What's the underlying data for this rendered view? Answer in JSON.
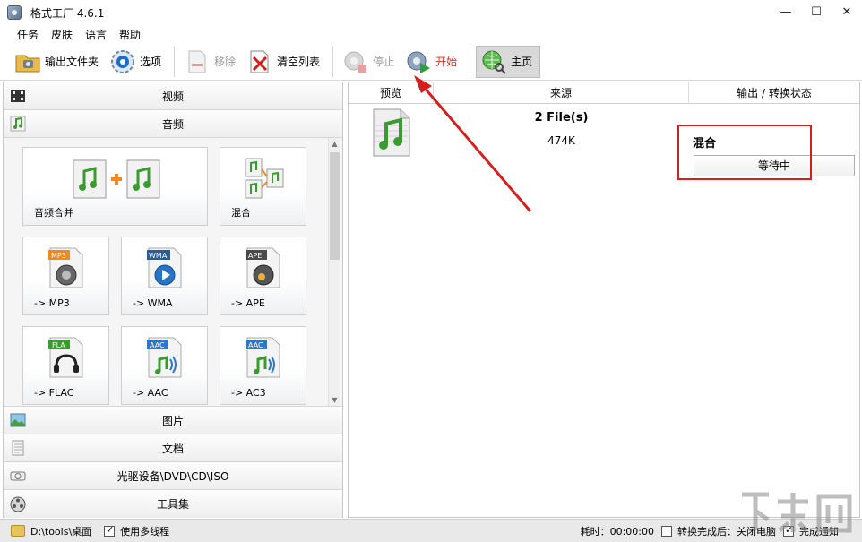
{
  "window": {
    "title": "格式工厂 4.6.1",
    "controls": [
      "—",
      "☐",
      "✕"
    ]
  },
  "menu": [
    "任务",
    "皮肤",
    "语言",
    "帮助"
  ],
  "toolbar": {
    "output_folder": "输出文件夹",
    "options": "选项",
    "remove": "移除",
    "clear_list": "清空列表",
    "stop": "停止",
    "start": "开始",
    "home": "主页"
  },
  "categories": {
    "video": "视频",
    "audio": "音频",
    "picture": "图片",
    "document": "文档",
    "rom": "光驱设备\\DVD\\CD\\ISO",
    "tools": "工具集"
  },
  "audio_tiles": [
    {
      "label": "音频合并"
    },
    {
      "label": "混合"
    },
    {
      "label": "-> MP3",
      "badge": "MP3"
    },
    {
      "label": "-> WMA",
      "badge": "WMA"
    },
    {
      "label": "-> APE",
      "badge": "APE"
    },
    {
      "label": "-> FLAC",
      "badge": "FLA"
    },
    {
      "label": "-> AAC",
      "badge": "AAC"
    },
    {
      "label": "-> AC3",
      "badge": "AAC"
    }
  ],
  "task_list": {
    "columns": [
      "预览",
      "来源",
      "输出 / 转换状态"
    ],
    "rows": [
      {
        "source": "2 File(s)",
        "size": "474K",
        "output": "混合",
        "status": "等待中"
      }
    ]
  },
  "statusbar": {
    "path": "D:\\tools\\桌面",
    "multithread_label": "使用多线程",
    "elapsed": "耗时：00:00:00",
    "shutdown_label": "转换完成后：关闭电脑",
    "notify_label": "完成通知"
  },
  "colors": {
    "annotation_red": "#d41f1f",
    "start_label": "#c0392b"
  }
}
